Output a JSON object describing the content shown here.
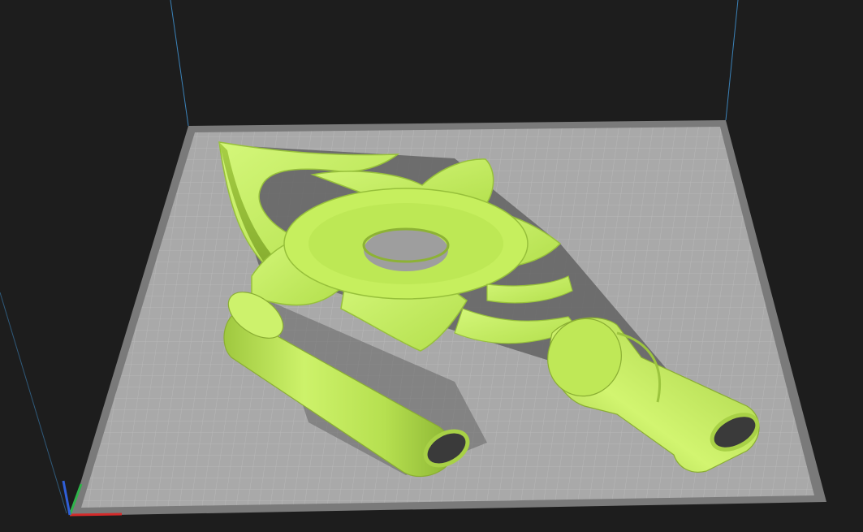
{
  "viewport": {
    "background_color": "#1d1d1d",
    "build_plate": {
      "surface_color": "#a9a9a9",
      "border_color": "#7a7a7a",
      "grid_color": "#c4c4c4",
      "grid": true
    },
    "build_volume_edge_color": "#3b82b8",
    "axes": [
      {
        "name": "x-axis",
        "color": "#d42a2a"
      },
      {
        "name": "y-axis",
        "color": "#2fb34a"
      },
      {
        "name": "z-axis",
        "color": "#2f5fd8"
      }
    ],
    "model": {
      "color": "#c6ef5e",
      "shadow_color": "#5e5e5e",
      "parts": [
        "flower-crossguard",
        "handle-cylinder-left",
        "handle-cylinder-right"
      ]
    }
  }
}
